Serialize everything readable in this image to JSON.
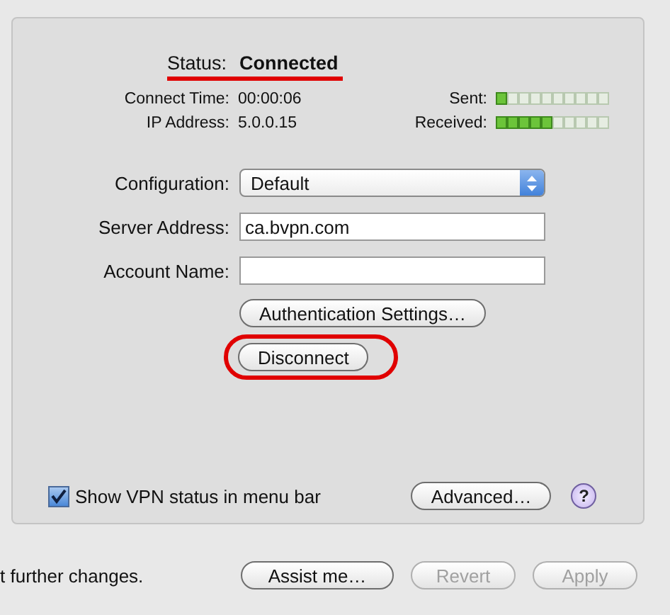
{
  "status": {
    "label": "Status:",
    "value": "Connected"
  },
  "info": [
    {
      "label": "Connect Time:",
      "value": "00:00:06",
      "meter_label": "Sent:",
      "level": 0.1
    },
    {
      "label": "IP Address:",
      "value": "5.0.0.15",
      "meter_label": "Received:",
      "level": 0.5
    }
  ],
  "configuration": {
    "label": "Configuration:",
    "value": "Default"
  },
  "server_address": {
    "label": "Server Address:",
    "value": "ca.bvpn.com"
  },
  "account_name": {
    "label": "Account Name:"
  },
  "authentication_button": "Authentication Settings…",
  "disconnect_button": "Disconnect",
  "show_status": {
    "label": "Show VPN status in menu bar",
    "checked": true
  },
  "advanced_button": "Advanced…",
  "help_button": "?",
  "footer_text": "t further changes.",
  "footer_buttons": [
    {
      "label": "Assist me…",
      "disabled": false
    },
    {
      "label": "Revert",
      "disabled": true
    },
    {
      "label": "Apply",
      "disabled": true
    }
  ]
}
